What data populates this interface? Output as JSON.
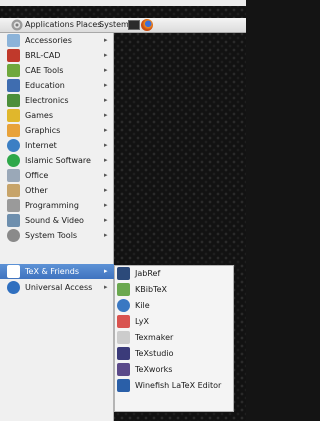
{
  "panel": {
    "applications_label": "Applications",
    "places_label": "Places",
    "system_label": "System"
  },
  "menu": {
    "items": [
      {
        "label": "Accessories",
        "icon": "accessories-icon",
        "color": "#8bb3d9"
      },
      {
        "label": "BRL-CAD",
        "icon": "brlcad-icon",
        "color": "#c0392b"
      },
      {
        "label": "CAE Tools",
        "icon": "cae-tools-icon",
        "color": "#6fa83c"
      },
      {
        "label": "Education",
        "icon": "education-icon",
        "color": "#3f6db0"
      },
      {
        "label": "Electronics",
        "icon": "electronics-icon",
        "color": "#4c8f3a"
      },
      {
        "label": "Games",
        "icon": "games-icon",
        "color": "#e0b72c"
      },
      {
        "label": "Graphics",
        "icon": "graphics-icon",
        "color": "#e8a23a"
      },
      {
        "label": "Internet",
        "icon": "internet-icon",
        "color": "#3c7fc4"
      },
      {
        "label": "Islamic Software",
        "icon": "islamic-software-icon",
        "color": "#2fa84a"
      },
      {
        "label": "Office",
        "icon": "office-icon",
        "color": "#9aa8b8"
      },
      {
        "label": "Other",
        "icon": "other-icon",
        "color": "#c7a46a"
      },
      {
        "label": "Programming",
        "icon": "programming-icon",
        "color": "#9a9a9a"
      },
      {
        "label": "Sound & Video",
        "icon": "sound-video-icon",
        "color": "#6e8fae"
      },
      {
        "label": "System Tools",
        "icon": "system-tools-icon",
        "color": "#8a8a8a"
      },
      {
        "label": "TeX & Friends",
        "icon": "tex-friends-icon",
        "color": "#ffffff"
      },
      {
        "label": "Universal Access",
        "icon": "universal-access-icon",
        "color": "#2f6fbf"
      }
    ],
    "active_item": "TeX & Friends",
    "arrow_glyph": "▸"
  },
  "submenu": {
    "items": [
      {
        "label": "JabRef",
        "icon": "jabref-icon",
        "color": "#2c4a7a"
      },
      {
        "label": "KBibTeX",
        "icon": "kbibtex-icon",
        "color": "#6aa84f"
      },
      {
        "label": "Kile",
        "icon": "kile-icon",
        "color": "#3a78c2"
      },
      {
        "label": "LyX",
        "icon": "lyx-icon",
        "color": "#d9534f"
      },
      {
        "label": "Texmaker",
        "icon": "texmaker-icon",
        "color": "#cccccc"
      },
      {
        "label": "TeXstudio",
        "icon": "texstudio-icon",
        "color": "#3b3b7a"
      },
      {
        "label": "TeXworks",
        "icon": "texworks-icon",
        "color": "#5b4a8a"
      },
      {
        "label": "Winefish LaTeX Editor",
        "icon": "winefish-icon",
        "color": "#2a5fa8"
      }
    ]
  }
}
